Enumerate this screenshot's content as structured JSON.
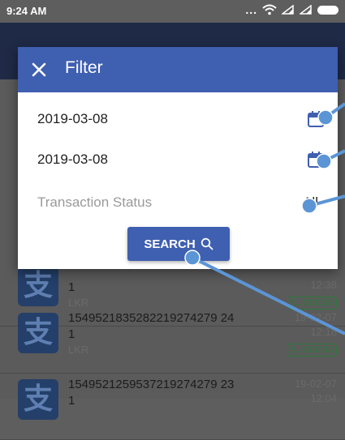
{
  "status_bar": {
    "time": "9:24 AM",
    "dots": "..."
  },
  "background_list": {
    "rows": [
      {
        "txn_id": "",
        "amount": "1",
        "currency": "LKR",
        "date": "",
        "time": "12:38",
        "status": "SUCCESS"
      },
      {
        "txn_id": "1549521835282219274279 24",
        "amount": "1",
        "currency": "LKR",
        "date": "19-02-07",
        "time": "12:18",
        "status": "SUCCESS"
      },
      {
        "txn_id": "1549521259537219274279 23",
        "amount": "1",
        "currency": "",
        "date": "19-02-07",
        "time": "12:04",
        "status": ""
      }
    ]
  },
  "filter_dialog": {
    "title": "Filter",
    "from_date": "2019-03-08",
    "to_date": "2019-03-08",
    "status_label": "Transaction Status",
    "status_value": "All",
    "search_label": "SEARCH"
  },
  "colors": {
    "primary": "#3f5fb0",
    "annotation": "#5b95d6",
    "success": "#2a7a3a"
  },
  "icons": [
    "close-icon",
    "calendar-icon",
    "search-icon",
    "wifi-icon",
    "signal-icon",
    "battery-icon",
    "alipay-icon"
  ]
}
